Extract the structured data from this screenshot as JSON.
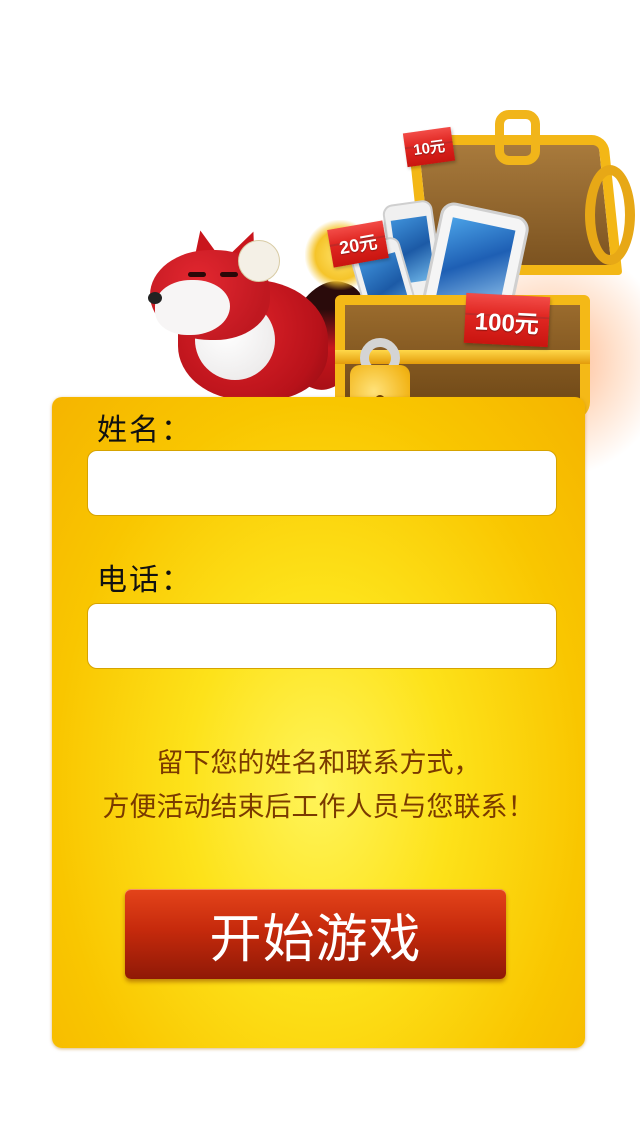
{
  "hero": {
    "envelopes": [
      {
        "label": "10元"
      },
      {
        "label": "20元"
      },
      {
        "label": "100元"
      }
    ]
  },
  "form": {
    "name_label": "姓名：",
    "name_value": "",
    "phone_label": "电话：",
    "phone_value": ""
  },
  "notice": {
    "line1": "留下您的姓名和联系方式，",
    "line2": "方便活动结束后工作人员与您联系！"
  },
  "start_button": {
    "label": "开始游戏"
  },
  "colors": {
    "panel": "#f9c600",
    "button": "#c62a0c",
    "notice_text": "#7a3a00"
  }
}
